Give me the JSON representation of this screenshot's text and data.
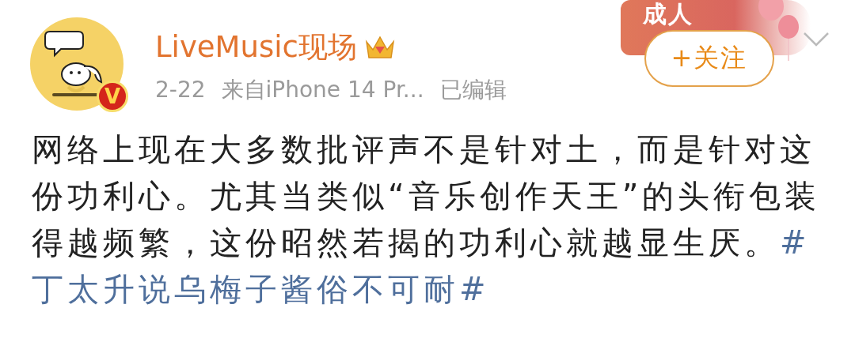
{
  "post": {
    "author": {
      "name": "LiveMusic现场",
      "verified_mark": "V"
    },
    "meta": {
      "date": "2-22",
      "source": "来自iPhone 14 Pr...",
      "edited": "已编辑"
    },
    "banner": {
      "text": "成人"
    },
    "follow_button": {
      "label": "+关注"
    },
    "body": {
      "lines": [
        [
          {
            "kind": "text",
            "text": "网络上现在大多数批评声不是针对土，而是针对这"
          }
        ],
        [
          {
            "kind": "text",
            "text": "份功利心。尤其当类似“音乐创作天王”的头衔包装"
          }
        ],
        [
          {
            "kind": "text",
            "text": "得越频繁，这份昭然若揭的功利心就越显生厌。"
          },
          {
            "kind": "hashtag",
            "text": "#"
          }
        ],
        [
          {
            "kind": "hashtag",
            "text": "丁太升说乌梅子酱俗不可耐#"
          }
        ]
      ]
    }
  }
}
